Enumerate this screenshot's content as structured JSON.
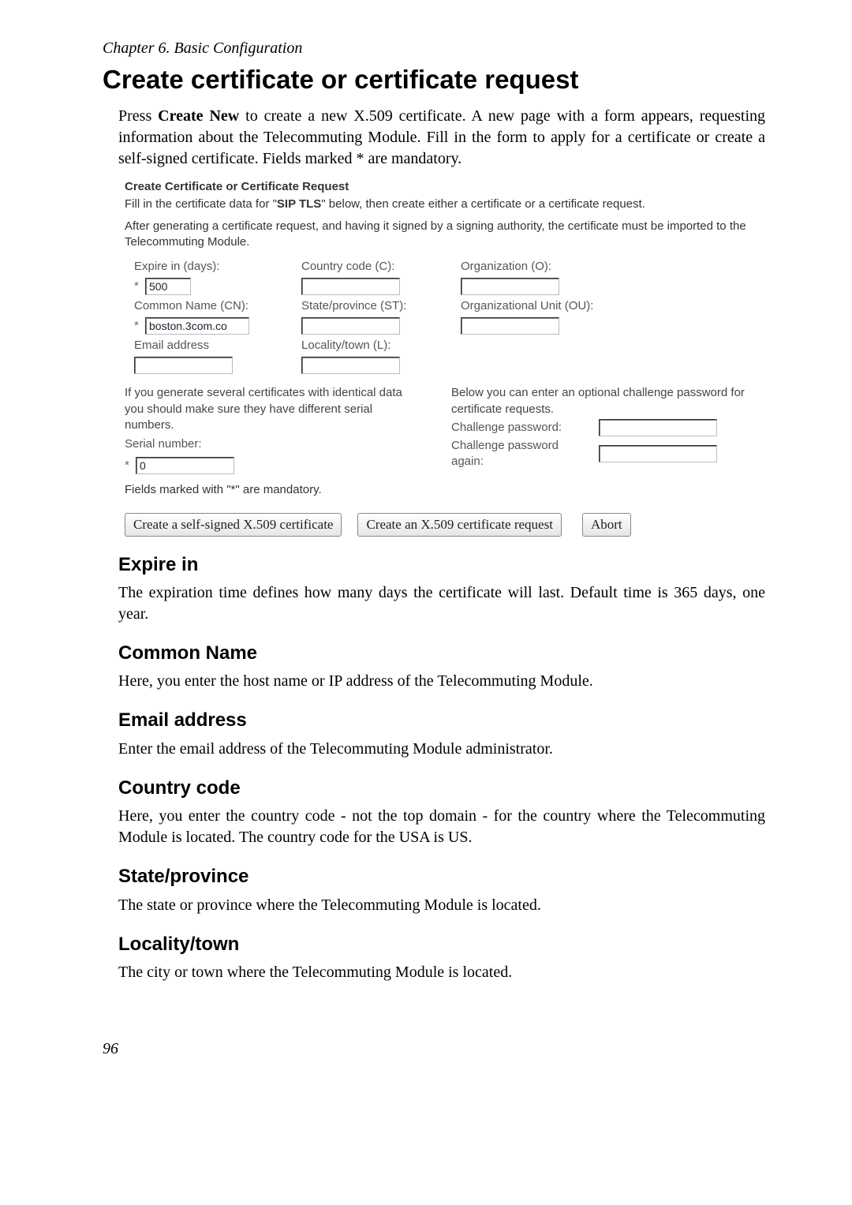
{
  "chapter_line": "Chapter 6. Basic Configuration",
  "page_title": "Create certificate or certificate request",
  "intro_prefix": "Press ",
  "intro_bold": "Create New",
  "intro_suffix": " to create a new X.509 certificate. A new page with a form appears, requesting information about the Telecommuting Module. Fill in the form to apply for a certificate or create a self-signed certificate. Fields marked * are mandatory.",
  "form": {
    "title": "Create Certificate or Certificate Request",
    "desc1_pre": "Fill in the certificate data for \"",
    "desc1_bold": "SIP TLS",
    "desc1_post": "\" below, then create either a certificate or a certificate request.",
    "desc2": "After generating a certificate request, and having it signed by a signing authority, the certificate must be imported to the Telecommuting Module.",
    "labels": {
      "expire": "Expire in (days):",
      "country": "Country code (C):",
      "org": "Organization (O):",
      "cn": "Common Name (CN):",
      "st": "State/province (ST):",
      "ou": "Organizational Unit (OU):",
      "email": "Email address",
      "loc": "Locality/town (L):"
    },
    "values": {
      "expire": "500",
      "cn": "boston.3com.co",
      "serial": "0"
    },
    "serial_note": "If you generate several certificates with identical data you should make sure they have different serial numbers.",
    "serial_label": "Serial number:",
    "challenge_note": "Below you can enter an optional challenge password for certificate requests.",
    "challenge_pw": "Challenge password:",
    "challenge_pw_again": "Challenge password again:",
    "mandatory_note": "Fields marked with \"*\" are mandatory.",
    "buttons": {
      "selfsigned": "Create a self-signed X.509 certificate",
      "request": "Create an X.509 certificate request",
      "abort": "Abort"
    }
  },
  "sections": {
    "expire": {
      "h": "Expire in",
      "b": "The expiration time defines how many days the certificate will last. Default time is 365 days, one year."
    },
    "cn": {
      "h": "Common Name",
      "b": "Here, you enter the host name or IP address of the Telecommuting Module."
    },
    "email": {
      "h": "Email address",
      "b": "Enter the email address of the Telecommuting Module administrator."
    },
    "cc": {
      "h": "Country code",
      "b": "Here, you enter the country code - not the top domain - for the country where the Telecommuting Module is located. The country code for the USA is US."
    },
    "sp": {
      "h": "State/province",
      "b": "The state or province where the Telecommuting Module is located."
    },
    "lt": {
      "h": "Locality/town",
      "b": "The city or town where the Telecommuting Module is located."
    }
  },
  "page_number": "96"
}
